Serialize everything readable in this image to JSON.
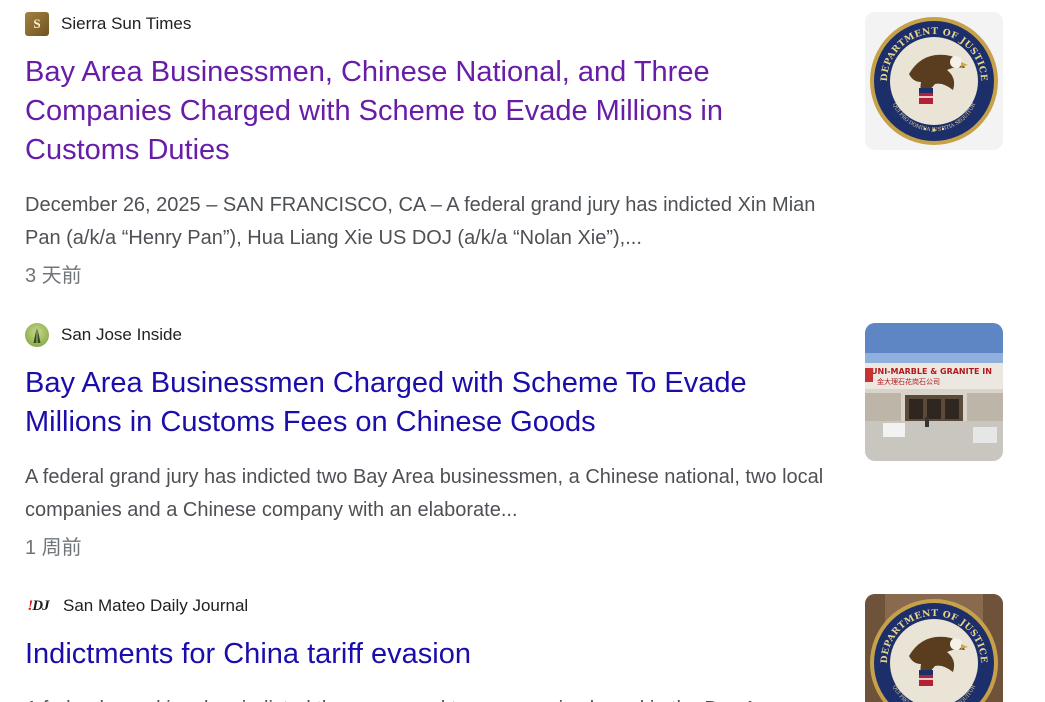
{
  "results": [
    {
      "source": "Sierra Sun Times",
      "favicon": "sierra-sun-times-logo",
      "title": "Bay Area Businessmen, Chinese National, and Three Companies Charged with Scheme to Evade Millions in Customs Duties",
      "snippet": "December 26, 2025 – SAN FRANCISCO, CA – A federal grand jury has indicted Xin Mian Pan (a/k/a “Henry Pan”), Hua Liang Xie US DOJ (a/k/a “Nolan Xie”),...",
      "age": "3 天前",
      "visited": true,
      "thumbnail": {
        "seal_text_top": "DEPARTMENT OF JUSTICE",
        "seal_text_bottom": "QUI PRO DOMINA JUSTITIA SEQUITUR"
      }
    },
    {
      "source": "San Jose Inside",
      "favicon": "san-jose-inside-logo",
      "title": "Bay Area Businessmen Charged with Scheme To Evade Millions in Customs Fees on Chinese Goods",
      "snippet": "A federal grand jury has indicted two Bay Area businessmen, a Chinese national, two local companies and a Chinese company with an elaborate...",
      "age": "1 周前",
      "visited": false,
      "thumbnail": {
        "sign_text": "UNI-MARBLE & GRANITE IN",
        "sign_text_cn": "金大理石花岗石公司"
      }
    },
    {
      "source": "San Mateo Daily Journal",
      "favicon": "san-mateo-daily-journal-logo",
      "title": "Indictments for China tariff evasion",
      "snippet": "A federal grand jury has indicted three men and two companies based in the Bay Area",
      "visited": false,
      "thumbnail": {
        "seal_text_top": "DEPARTMENT OF JUSTICE",
        "seal_text_bottom": "QUI PRO DOMINA JUSTITIA SEQUITUR"
      }
    }
  ],
  "favicon_text": {
    "sierra": "S",
    "smdj_prefix": "!",
    "smdj_main": "DJ"
  },
  "colors": {
    "visited_link": "#681da8",
    "link": "#1a0dab",
    "snippet": "#4d5156",
    "meta": "#70757a"
  }
}
